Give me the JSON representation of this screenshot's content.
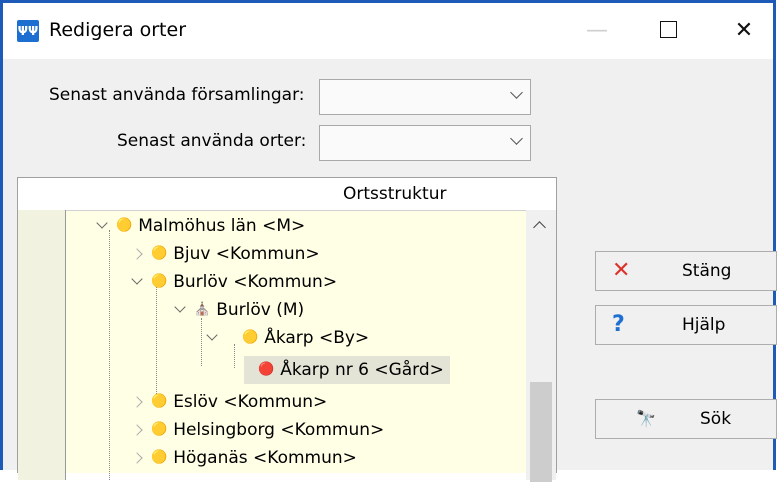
{
  "window": {
    "title": "Redigera orter",
    "icon": "app-icon"
  },
  "form": {
    "recent_parishes_label": "Senast använda församlingar:",
    "recent_places_label": "Senast använda orter:",
    "recent_parishes_value": "",
    "recent_places_value": ""
  },
  "tree": {
    "header": "Ortsstruktur",
    "nodes": [
      {
        "label": "Malmöhus län <M>",
        "icon": "county-icon",
        "expanded": true
      },
      {
        "label": "Bjuv <Kommun>",
        "icon": "municipality-icon",
        "expanded": false
      },
      {
        "label": "Burlöv <Kommun>",
        "icon": "municipality-icon",
        "expanded": true
      },
      {
        "label": "Burlöv (M)",
        "icon": "parish-icon",
        "expanded": true
      },
      {
        "label": "Åkarp <By>",
        "icon": "village-icon",
        "expanded": true
      },
      {
        "label": "Åkarp nr 6 <Gård>",
        "icon": "farm-icon",
        "selected": true
      },
      {
        "label": "Eslöv <Kommun>",
        "icon": "municipality-icon",
        "expanded": false
      },
      {
        "label": "Helsingborg <Kommun>",
        "icon": "municipality-icon",
        "expanded": false
      },
      {
        "label": "Höganäs <Kommun>",
        "icon": "municipality-icon",
        "expanded": false
      }
    ]
  },
  "buttons": {
    "close": {
      "label": "Stäng",
      "icon": "close-x-icon",
      "color": "#d9342b"
    },
    "help": {
      "label": "Hjälp",
      "icon": "question-icon",
      "color": "#1e6fd0"
    },
    "search": {
      "label": "Sök",
      "icon": "binoculars-icon"
    }
  }
}
